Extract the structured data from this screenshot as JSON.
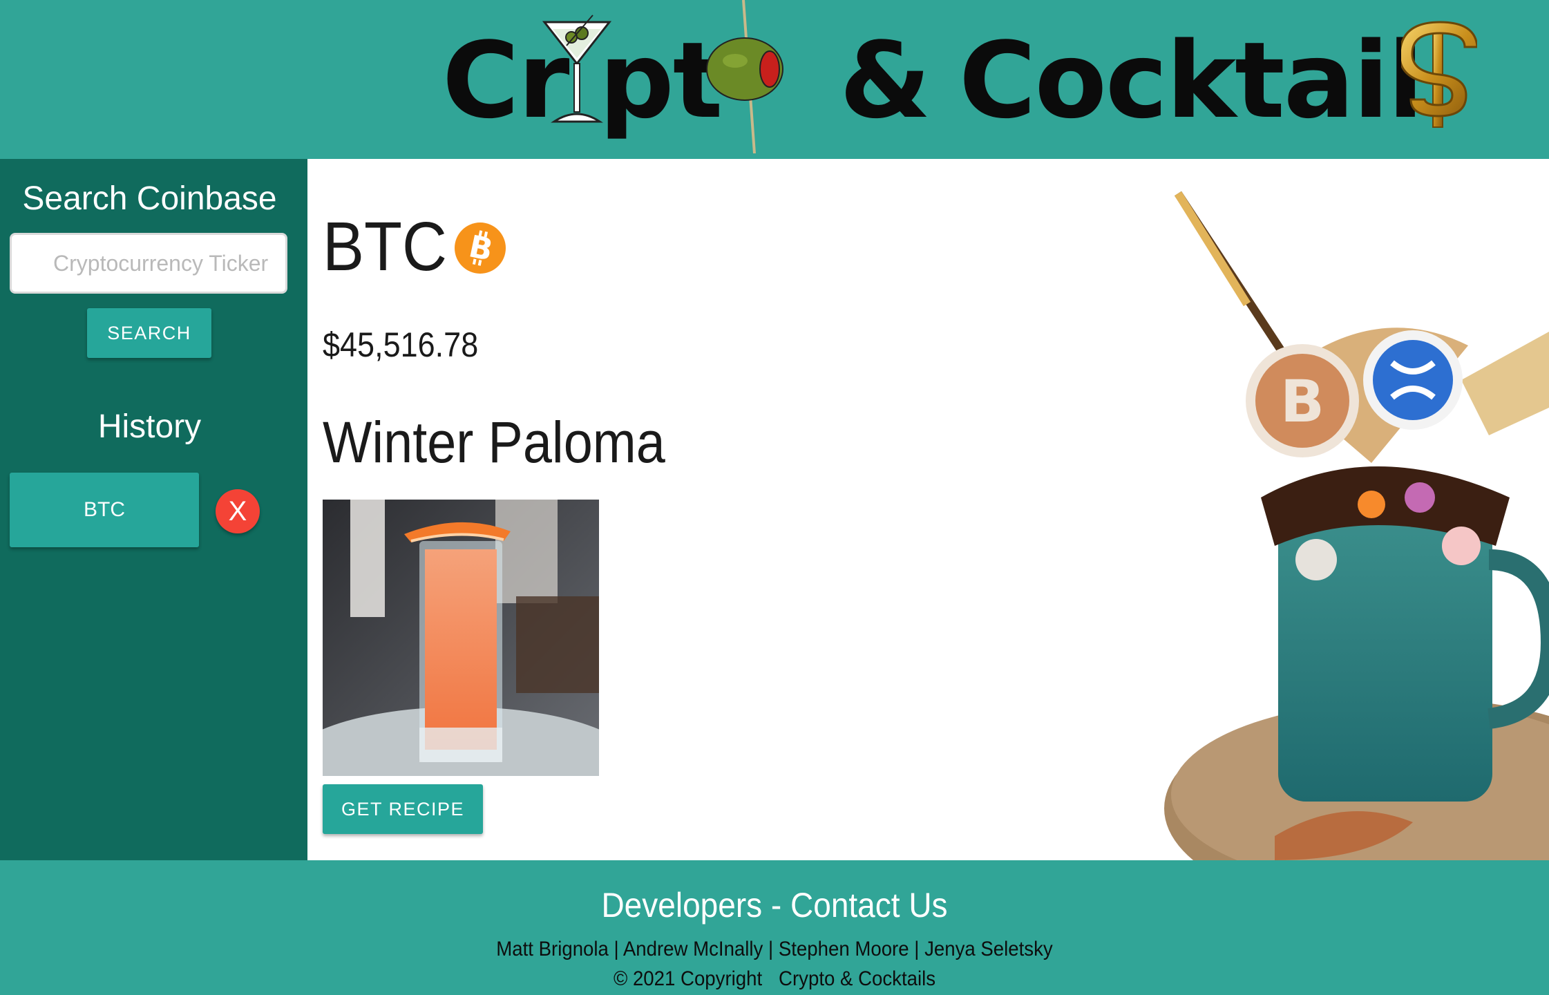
{
  "header": {
    "logo_text": "Crypto & Cocktails",
    "logo_parts": {
      "cr": "Cr",
      "pt": "pt",
      "amp": "&",
      "cocktail": "Cocktail"
    }
  },
  "sidebar": {
    "search_title": "Search Coinbase",
    "search_placeholder": "Cryptocurrency Ticker",
    "search_value": "",
    "search_button": "SEARCH",
    "history_title": "History",
    "history": [
      {
        "label": "BTC",
        "delete_label": "X"
      }
    ]
  },
  "main": {
    "coin_symbol": "BTC",
    "coin_icon": "bitcoin-icon",
    "price": "$45,516.78",
    "cocktail_name": "Winter Paloma",
    "recipe_button": "GET RECIPE"
  },
  "footer": {
    "title": "Developers - Contact Us",
    "developers": "Matt Brignola | Andrew McInally | Stephen Moore | Jenya Seletsky",
    "copyright": "© 2021 Copyright",
    "brand": "Crypto & Cocktails"
  },
  "colors": {
    "header": "#31a597",
    "sidebar": "#106b5d",
    "button": "#26a69a",
    "delete": "#f44336",
    "bitcoin": "#f7931a"
  }
}
